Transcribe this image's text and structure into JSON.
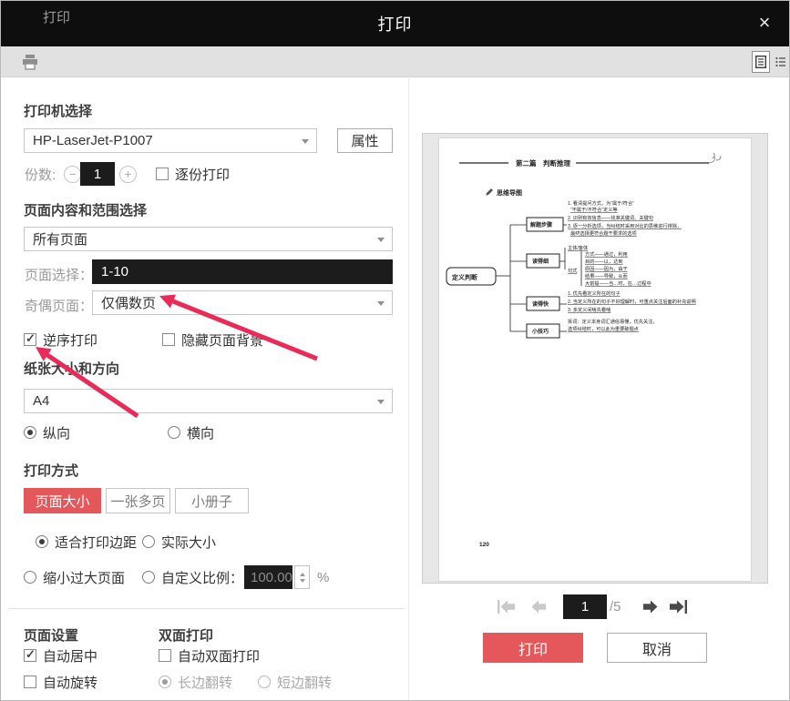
{
  "titlebar": {
    "title": "打印"
  },
  "toolbar": {
    "label": "打印"
  },
  "printer": {
    "section": "打印机选择",
    "name": "HP-LaserJet-P1007",
    "properties": "属性",
    "copies_label": "份数:",
    "copies_value": "1",
    "collate": "逐份打印"
  },
  "range": {
    "section": "页面内容和范围选择",
    "all_pages": "所有页面",
    "page_select_label": "页面选择：",
    "page_select_value": "1-10",
    "odd_even_label": "奇偶页面：",
    "odd_even_value": "仅偶数页",
    "reverse": "逆序打印",
    "hide_bg": "隐藏页面背景"
  },
  "paper": {
    "section": "纸张大小和方向",
    "size": "A4",
    "portrait": "纵向",
    "landscape": "横向"
  },
  "mode": {
    "section": "打印方式",
    "tabs": [
      "页面大小",
      "一张多页",
      "小册子"
    ],
    "fit": "适合打印边距",
    "actual": "实际大小",
    "shrink": "缩小过大页面",
    "custom": "自定义比例：",
    "custom_value": "100.00",
    "percent": "%"
  },
  "page_setup": {
    "section": "页面设置",
    "auto_center": "自动居中",
    "auto_rotate": "自动旋转"
  },
  "duplex": {
    "section": "双面打印",
    "auto_duplex": "自动双面打印",
    "long_edge": "长边翻转",
    "short_edge": "短边翻转"
  },
  "preview": {
    "header": "第二篇　判断推理",
    "map_title": "思维导图",
    "root": "定义判断",
    "b1": {
      "label": "解题步骤",
      "lines": [
        "1. 看清提问方式，为“属于/符合”",
        "“不属于/不符合”定义等",
        "2. 识别有效信息——找准关键词、关键句",
        "3. 逐一分析选项，当纠结时采用对比的思维进行排除，",
        "最终选择更符合题干要求的选项"
      ]
    },
    "b2": {
      "label": "读得细",
      "head": "主体/客体",
      "sent": "句式",
      "lines": [
        "方式——通过，利用",
        "目的——以，达到",
        "原因——因为，由于",
        "结果——导致，从而",
        "大前提——当…时，在…过程中"
      ]
    },
    "b3": {
      "label": "读得快",
      "lines": [
        "1. 优先看定义所在的句子",
        "2. 当定义所在的句子不好理解时，可重点关注后面的补充说明",
        "3. 多定义间啥先看啥"
      ]
    },
    "b4": {
      "label": "小技巧",
      "lines": [
        "拆词：定义本身词汇通俗易懂，优先关注，",
        "选项纠结时，可以此为重要破题点"
      ]
    },
    "page_number": "120",
    "nav": {
      "page": "1",
      "total": "/5"
    }
  },
  "actions": {
    "print": "打印",
    "cancel": "取消"
  },
  "colors": {
    "titlebar_bg": "#0e0e0e",
    "toolbar_bg": "#e1e1e1",
    "accent_red": "#e4585c",
    "annotation_arrow_red": "#ea2a57",
    "dark_input_bg": "#1c1c1c"
  }
}
